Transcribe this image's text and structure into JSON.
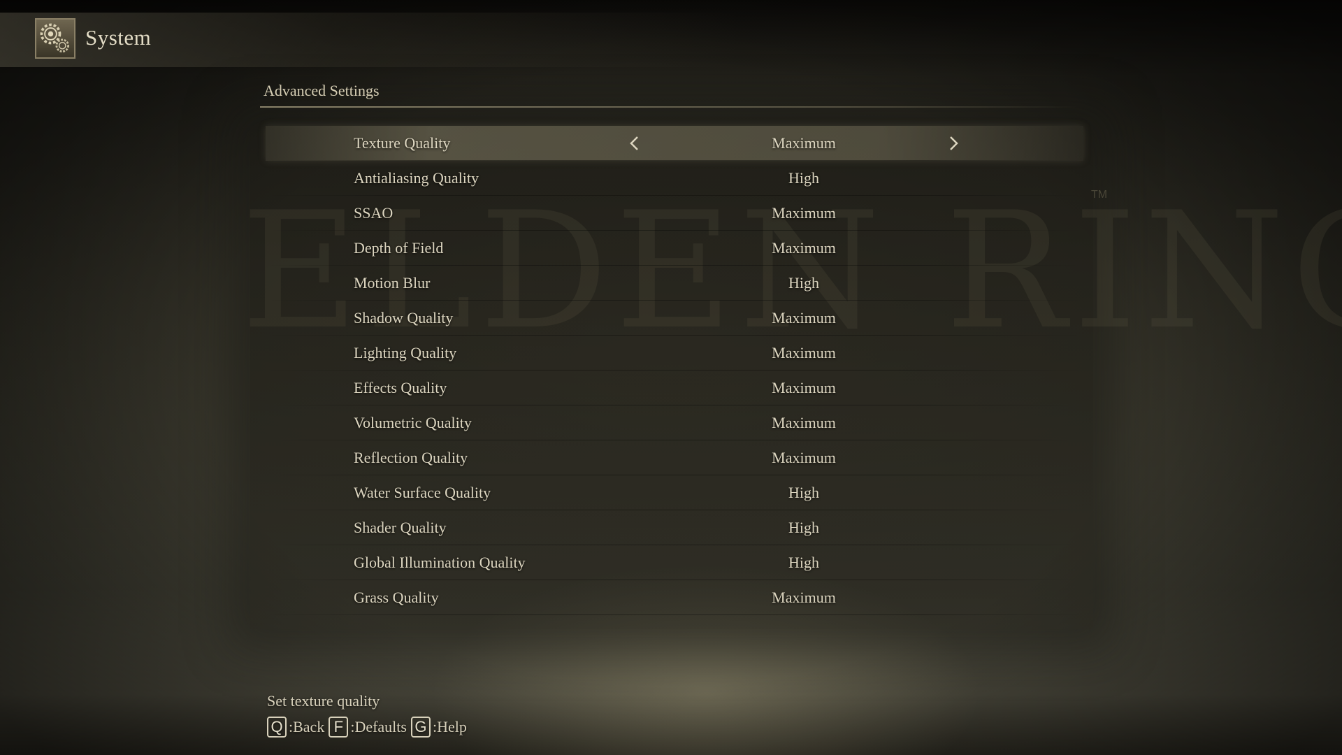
{
  "header": {
    "title": "System",
    "icon": "gear-icon"
  },
  "section": {
    "title": "Advanced Settings"
  },
  "watermark": {
    "text": "ELDEN RING",
    "tm": "TM"
  },
  "settings": [
    {
      "label": "Texture Quality",
      "value": "Maximum",
      "selected": true
    },
    {
      "label": "Antialiasing Quality",
      "value": "High"
    },
    {
      "label": "SSAO",
      "value": "Maximum"
    },
    {
      "label": "Depth of Field",
      "value": "Maximum"
    },
    {
      "label": "Motion Blur",
      "value": "High"
    },
    {
      "label": "Shadow Quality",
      "value": "Maximum"
    },
    {
      "label": "Lighting Quality",
      "value": "Maximum"
    },
    {
      "label": "Effects Quality",
      "value": "Maximum"
    },
    {
      "label": "Volumetric Quality",
      "value": "Maximum"
    },
    {
      "label": "Reflection Quality",
      "value": "Maximum"
    },
    {
      "label": "Water Surface Quality",
      "value": "High"
    },
    {
      "label": "Shader Quality",
      "value": "High"
    },
    {
      "label": "Global Illumination Quality",
      "value": "High"
    },
    {
      "label": "Grass Quality",
      "value": "Maximum"
    }
  ],
  "footer": {
    "help_text": "Set texture quality",
    "controls": [
      {
        "key": "Q",
        "label": ":Back"
      },
      {
        "key": "F",
        "label": ":Defaults"
      },
      {
        "key": "G",
        "label": ":Help"
      }
    ]
  },
  "colors": {
    "text": "#ddd6c0",
    "accent": "#d8d1bb",
    "background": "#2b2a22"
  }
}
